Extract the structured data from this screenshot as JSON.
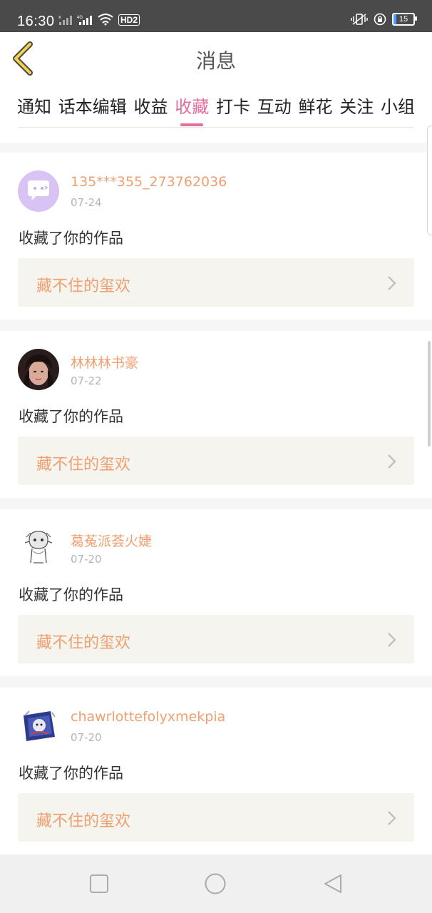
{
  "status_bar": {
    "time": "16:30",
    "hd_label": "HD2",
    "battery": "15"
  },
  "header": {
    "title": "消息",
    "back_icon": "chevron-left-icon"
  },
  "tabs": [
    {
      "label": "通知"
    },
    {
      "label": "话本编辑"
    },
    {
      "label": "收益"
    },
    {
      "label": "收藏",
      "active": true
    },
    {
      "label": "打卡"
    },
    {
      "label": "互动"
    },
    {
      "label": "鲜花"
    },
    {
      "label": "关注"
    },
    {
      "label": "小组"
    }
  ],
  "colors": {
    "accent": "#e66da0",
    "username": "#f0a070",
    "work_bg": "#f5f4ee"
  },
  "messages": [
    {
      "username": "135***355_273762036",
      "date": "07-24",
      "action": "收藏了你的作品",
      "work_title": "藏不住的玺欢",
      "avatar": "chat-bubble-avatar"
    },
    {
      "username": "林林林书豪",
      "date": "07-22",
      "action": "收藏了你的作品",
      "work_title": "藏不住的玺欢",
      "avatar": "photo-avatar"
    },
    {
      "username": "葛菟派荟火婕",
      "date": "07-20",
      "action": "收藏了你的作品",
      "work_title": "藏不住的玺欢",
      "avatar": "sketch-avatar"
    },
    {
      "username": "chawrlottefolyxmekpia",
      "date": "07-20",
      "action": "收藏了你的作品",
      "work_title": "藏不住的玺欢",
      "avatar": "anime-avatar"
    }
  ],
  "nav_bar": {
    "icons": [
      "recent-apps-icon",
      "home-icon",
      "back-icon"
    ]
  }
}
